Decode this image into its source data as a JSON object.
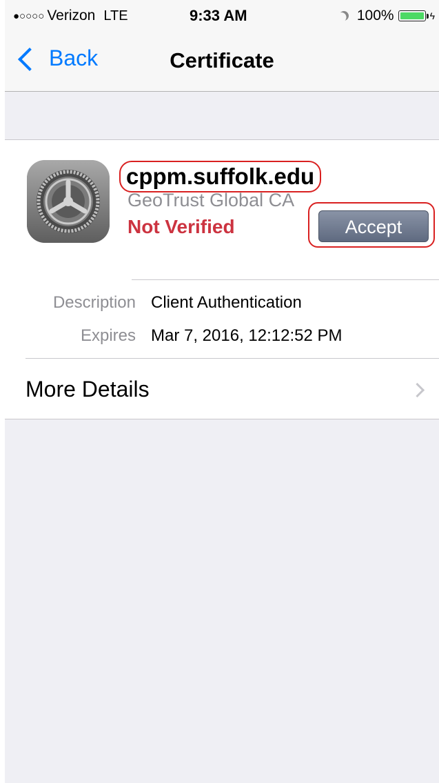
{
  "status_bar": {
    "signal": "●○○○○",
    "carrier": "Verizon",
    "network": "LTE",
    "time": "9:33 AM",
    "battery_percent": "100%"
  },
  "nav": {
    "back_label": "Back",
    "title": "Certificate"
  },
  "certificate": {
    "name": "cppm.suffolk.edu",
    "issuer": "GeoTrust Global CA",
    "status": "Not Verified",
    "accept_label": "Accept",
    "details": [
      {
        "label": "Description",
        "value": "Client Authentication"
      },
      {
        "label": "Expires",
        "value": "Mar 7, 2016, 12:12:52 PM"
      }
    ],
    "more_details_label": "More Details"
  },
  "colors": {
    "accent": "#007aff",
    "status_not_verified": "#cc3340",
    "highlight_outline": "#d92020",
    "battery": "#4cd964"
  },
  "icons": [
    "moon-icon",
    "battery-icon",
    "chevron-left-icon",
    "gear-icon",
    "chevron-right-icon"
  ]
}
